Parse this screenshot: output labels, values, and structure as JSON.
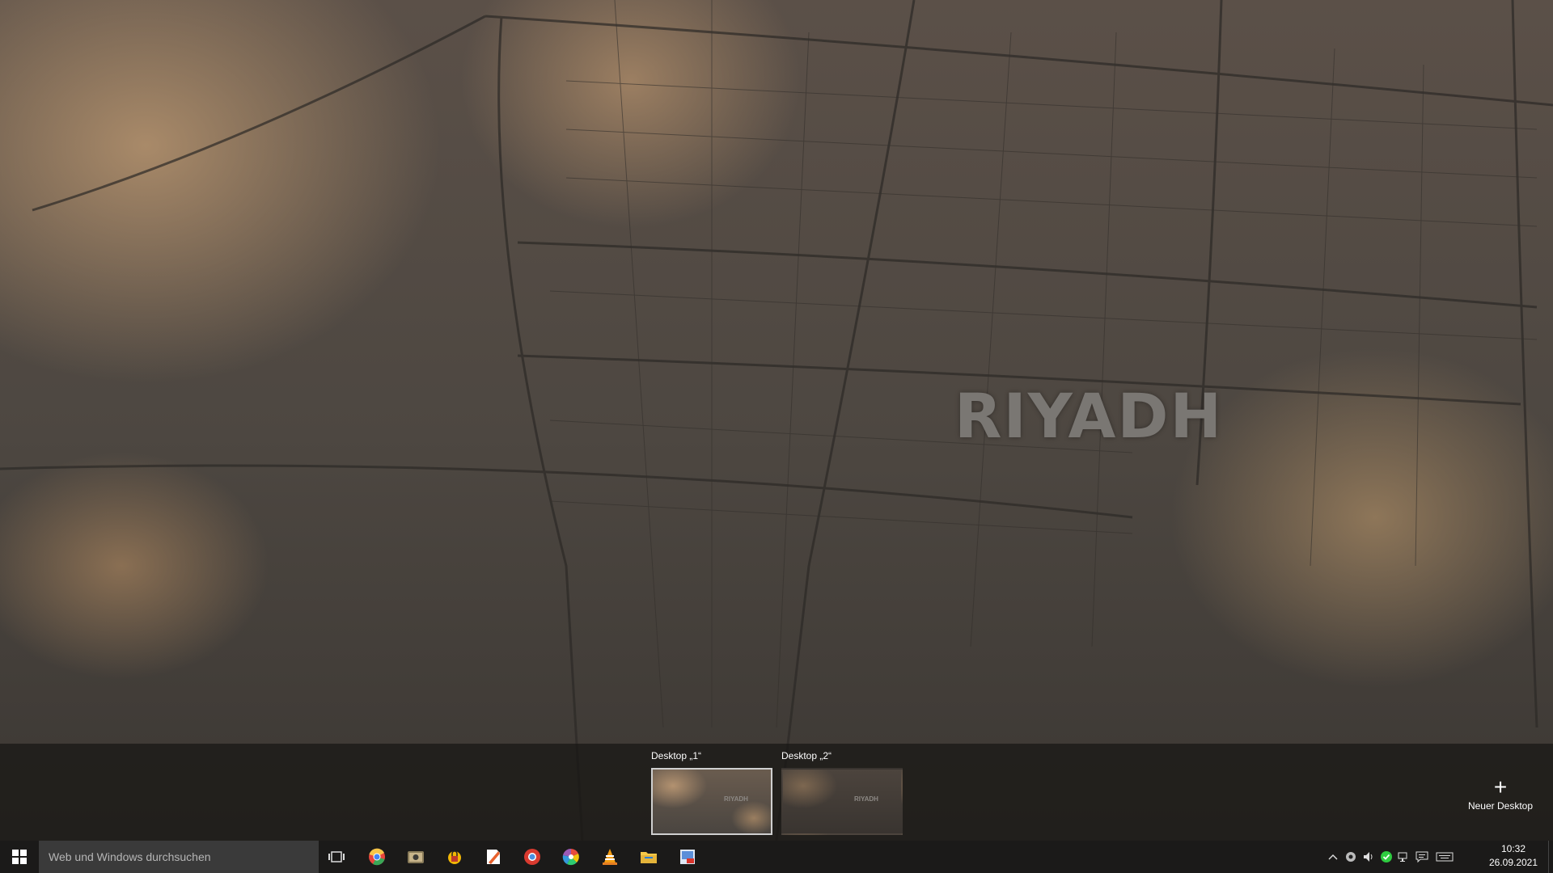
{
  "wallpaper": {
    "label": "RIYADH"
  },
  "task_view": {
    "desktops": [
      {
        "label": "Desktop „1“",
        "active": true
      },
      {
        "label": "Desktop „2“",
        "active": false
      }
    ],
    "new_desktop": {
      "icon": "plus-icon",
      "label": "Neuer Desktop"
    }
  },
  "taskbar": {
    "start_icon": "windows-logo-icon",
    "search_placeholder": "Web und Windows durchsuchen",
    "task_view_icon": "task-view-icon",
    "apps": [
      {
        "name": "chrome",
        "icon": "chrome-icon",
        "color": "#e8453c"
      },
      {
        "name": "photo-viewer",
        "icon": "photo-viewer-icon",
        "color": "#8a7c5a"
      },
      {
        "name": "vpn-app",
        "icon": "vpn-icon",
        "color": "#f2b705"
      },
      {
        "name": "pdf-editor",
        "icon": "pdf-editor-icon",
        "color": "#e8612c"
      },
      {
        "name": "chrome-alt",
        "icon": "chrome-alt-icon",
        "color": "#d93a2f"
      },
      {
        "name": "picasa",
        "icon": "picasa-icon",
        "color": "#9b59b6"
      },
      {
        "name": "vlc",
        "icon": "vlc-icon",
        "color": "#f39c12"
      },
      {
        "name": "file-explorer",
        "icon": "folder-icon",
        "color": "#f7c948"
      },
      {
        "name": "image-app",
        "icon": "image-app-icon",
        "color": "#5b8fd9"
      }
    ],
    "tray": {
      "icons": [
        "chevron-up-icon",
        "network-device-icon",
        "volume-icon",
        "security-check-icon",
        "network-icon",
        "notifications-icon",
        "keyboard-icon"
      ],
      "time": "10:32",
      "date": "26.09.2021"
    }
  }
}
